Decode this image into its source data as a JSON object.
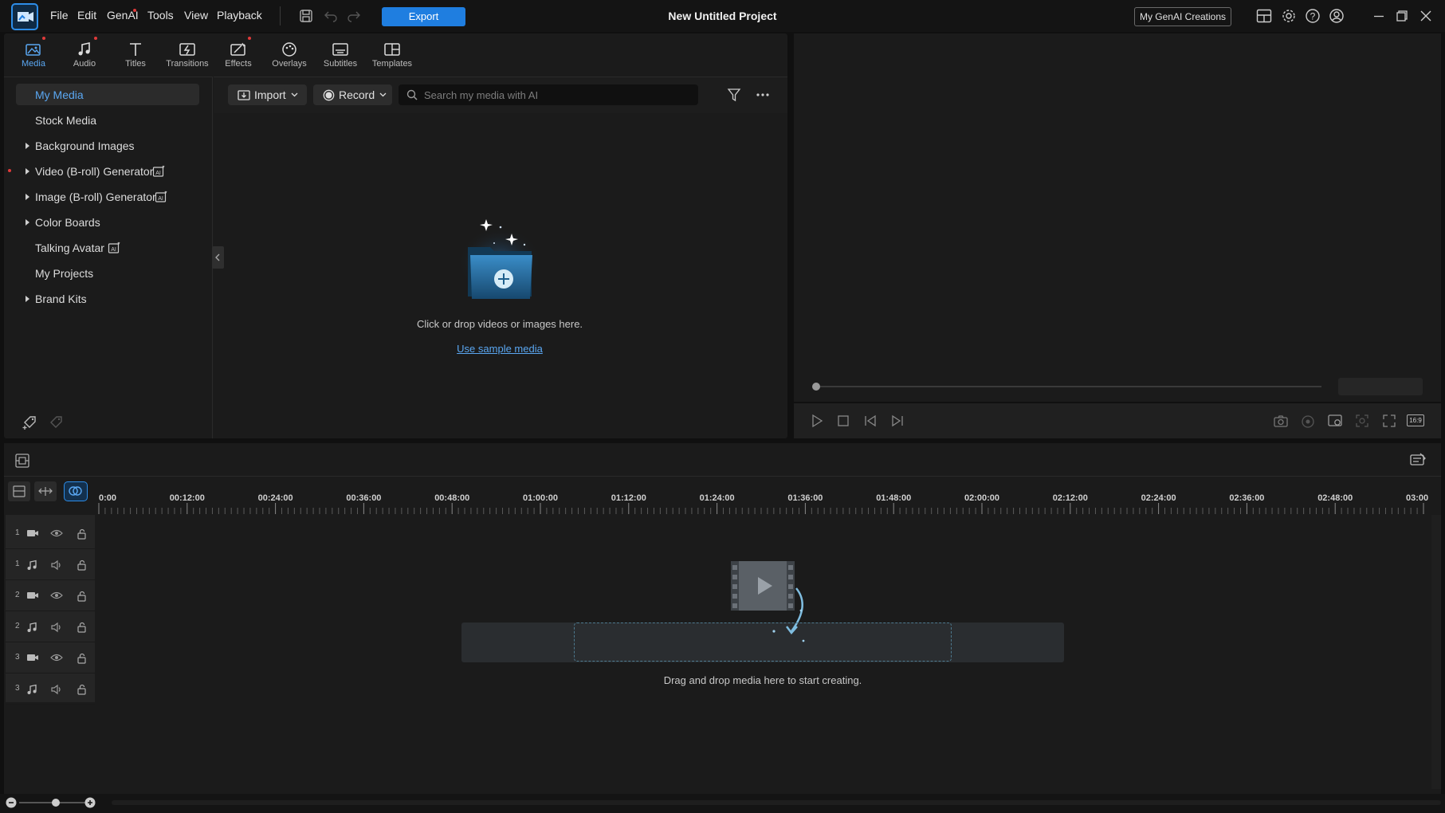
{
  "titlebar": {
    "menu": [
      "File",
      "Edit",
      "GenAI",
      "Tools",
      "View",
      "Playback"
    ],
    "export_label": "Export",
    "project_title": "New Untitled Project",
    "genai_button": "My GenAI Creations"
  },
  "tabs": [
    {
      "label": "Media",
      "icon": "media-icon",
      "active": true
    },
    {
      "label": "Audio",
      "icon": "music-note-icon"
    },
    {
      "label": "Titles",
      "icon": "text-t-icon"
    },
    {
      "label": "Transitions",
      "icon": "transition-icon"
    },
    {
      "label": "Effects",
      "icon": "effects-icon"
    },
    {
      "label": "Overlays",
      "icon": "overlays-icon"
    },
    {
      "label": "Subtitles",
      "icon": "subtitles-icon"
    },
    {
      "label": "Templates",
      "icon": "templates-icon"
    }
  ],
  "sidebar": {
    "items": [
      {
        "label": "My Media"
      },
      {
        "label": "Stock Media"
      },
      {
        "label": "Background Images"
      },
      {
        "label": "Video (B-roll) Generator"
      },
      {
        "label": "Image (B-roll) Generator"
      },
      {
        "label": "Color Boards"
      },
      {
        "label": "Talking Avatar"
      },
      {
        "label": "My Projects"
      },
      {
        "label": "Brand Kits"
      }
    ]
  },
  "media": {
    "import_label": "Import",
    "record_label": "Record",
    "search_placeholder": "Search my media with AI",
    "empty_text": "Click or drop videos or images here.",
    "sample_link": "Use sample media"
  },
  "timeline": {
    "ruler": [
      "0:00",
      "00:12:00",
      "00:24:00",
      "00:36:00",
      "00:48:00",
      "01:00:00",
      "01:12:00",
      "01:24:00",
      "01:36:00",
      "01:48:00",
      "02:00:00",
      "02:12:00",
      "02:24:00",
      "02:36:00",
      "02:48:00",
      "03:00"
    ],
    "tracks": [
      {
        "num": "1",
        "type": "video"
      },
      {
        "num": "1",
        "type": "audio"
      },
      {
        "num": "2",
        "type": "video"
      },
      {
        "num": "2",
        "type": "audio"
      },
      {
        "num": "3",
        "type": "video"
      },
      {
        "num": "3",
        "type": "audio"
      }
    ],
    "drop_text": "Drag and drop media here to start creating."
  },
  "preview": {
    "aspect_label": "16:9"
  },
  "colors": {
    "accent": "#1f7ee0",
    "link": "#5aa7f2"
  }
}
